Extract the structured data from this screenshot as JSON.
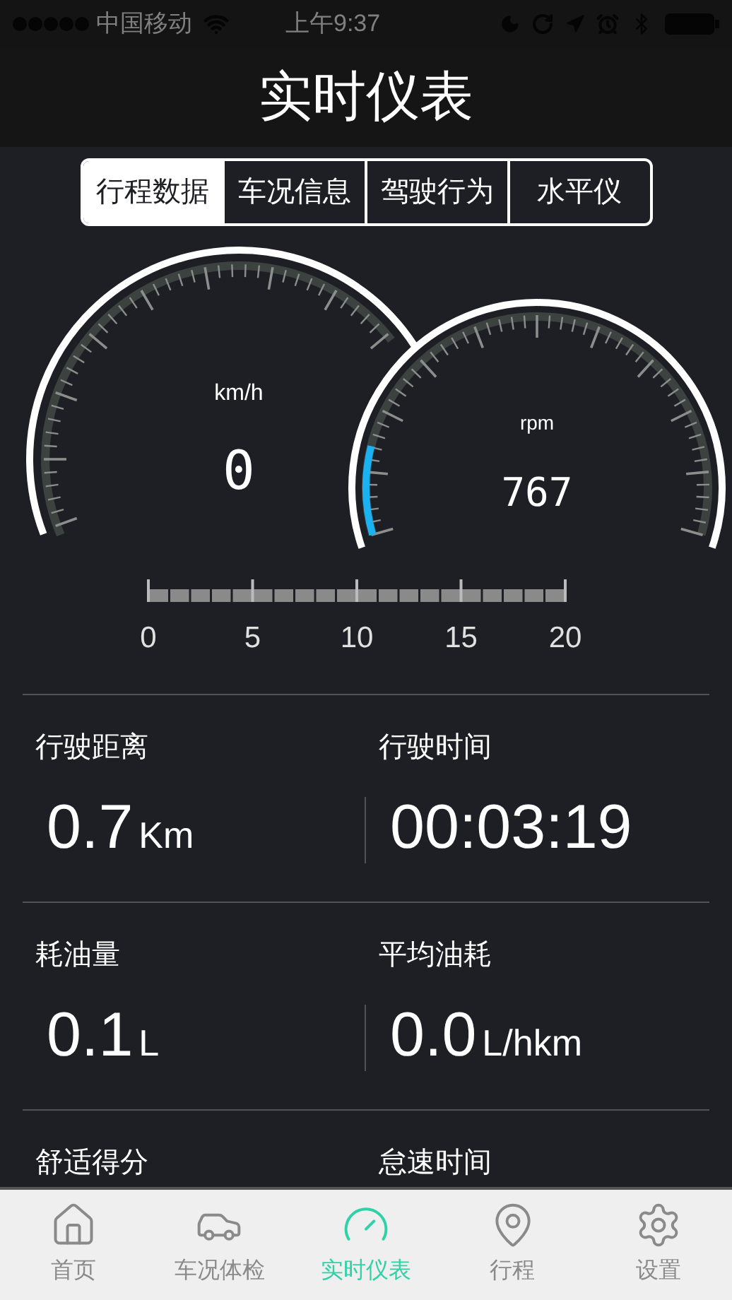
{
  "status_bar": {
    "carrier": "中国移动",
    "time": "上午9:37"
  },
  "header": {
    "title": "实时仪表"
  },
  "tabs": [
    {
      "label": "行程数据",
      "selected": true
    },
    {
      "label": "车况信息",
      "selected": false
    },
    {
      "label": "驾驶行为",
      "selected": false
    },
    {
      "label": "水平仪",
      "selected": false
    }
  ],
  "speed_gauge": {
    "unit": "km/h",
    "reading": "0",
    "scale_labels": [
      "0",
      "5",
      "10",
      "15",
      "20"
    ]
  },
  "rpm_gauge": {
    "unit": "rpm",
    "reading": "767"
  },
  "stats": [
    {
      "label": "行驶距离",
      "value": "0.7",
      "unit": "Km"
    },
    {
      "label": "行驶时间",
      "value": "00:03:19"
    },
    {
      "label": "耗油量",
      "value": "0.1",
      "unit": "L"
    },
    {
      "label": "平均油耗",
      "value": "0.0",
      "unit": "L/hkm"
    },
    {
      "label": "舒适得分"
    },
    {
      "label": "怠速时间"
    }
  ],
  "tab_bar": [
    {
      "kind": "home",
      "label": "首页",
      "selected": false
    },
    {
      "kind": "car",
      "label": "车况体检",
      "selected": false
    },
    {
      "kind": "gauge",
      "label": "实时仪表",
      "selected": true
    },
    {
      "kind": "pin",
      "label": "行程",
      "selected": false
    },
    {
      "kind": "settings",
      "label": "设置",
      "selected": false
    }
  ]
}
